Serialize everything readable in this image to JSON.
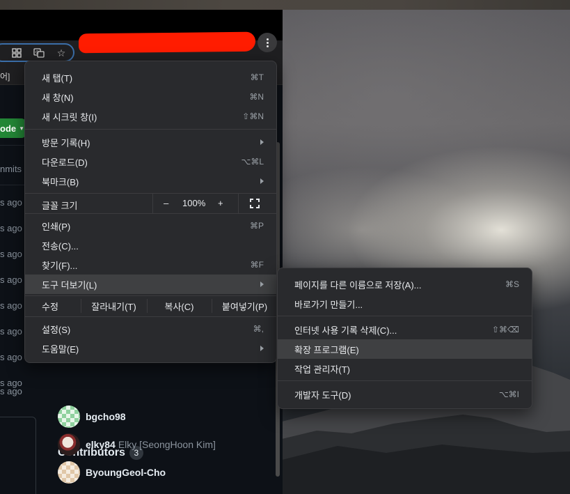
{
  "browser": {
    "toolbar": {
      "extensions_icon": "puzzle-icon",
      "translate_icon": "translate-icon",
      "bookmark_icon": "star-icon",
      "menu_icon": "kebab-menu-icon"
    },
    "bookmarks_bar": {
      "fragment": "어]"
    }
  },
  "page": {
    "code_button": "ode",
    "commits_fragment": "nmits",
    "time_fragments": [
      "s ago",
      "s ago",
      "s ago",
      "s ago",
      "s ago",
      "s ago",
      "s ago",
      "s ago",
      "s ago"
    ],
    "contributors": {
      "title": "Contributors",
      "count": "3",
      "list": [
        {
          "login": "bgcho98",
          "name": ""
        },
        {
          "login": "elky84",
          "name": "Elky [SeongHoon Kim]"
        },
        {
          "login": "ByoungGeol-Cho",
          "name": ""
        }
      ]
    }
  },
  "menu": {
    "new_tab": {
      "label": "새 탭(T)",
      "shortcut": "⌘T"
    },
    "new_window": {
      "label": "새 창(N)",
      "shortcut": "⌘N"
    },
    "incognito": {
      "label": "새 시크릿 창(I)",
      "shortcut": "⇧⌘N"
    },
    "history": {
      "label": "방문 기록(H)"
    },
    "downloads": {
      "label": "다운로드(D)",
      "shortcut": "⌥⌘L"
    },
    "bookmarks": {
      "label": "북마크(B)"
    },
    "zoom": {
      "label": "글꼴 크기",
      "minus": "–",
      "value": "100%",
      "plus": "+"
    },
    "print": {
      "label": "인쇄(P)",
      "shortcut": "⌘P"
    },
    "cast": {
      "label": "전송(C)..."
    },
    "find": {
      "label": "찾기(F)...",
      "shortcut": "⌘F"
    },
    "more_tools": {
      "label": "도구 더보기(L)"
    },
    "edit": {
      "label": "수정",
      "cut": "잘라내기(T)",
      "copy": "복사(C)",
      "paste": "붙여넣기(P)"
    },
    "settings": {
      "label": "설정(S)",
      "shortcut": "⌘,"
    },
    "help": {
      "label": "도움말(E)"
    }
  },
  "submenu": {
    "save_as": {
      "label": "페이지를 다른 이름으로 저장(A)...",
      "shortcut": "⌘S"
    },
    "create_shortcut": {
      "label": "바로가기 만들기..."
    },
    "clear_data": {
      "label": "인터넷 사용 기록 삭제(C)...",
      "shortcut": "⇧⌘⌫"
    },
    "extensions": {
      "label": "확장 프로그램(E)"
    },
    "task_manager": {
      "label": "작업 관리자(T)"
    },
    "dev_tools": {
      "label": "개발자 도구(D)",
      "shortcut": "⌥⌘I"
    }
  }
}
